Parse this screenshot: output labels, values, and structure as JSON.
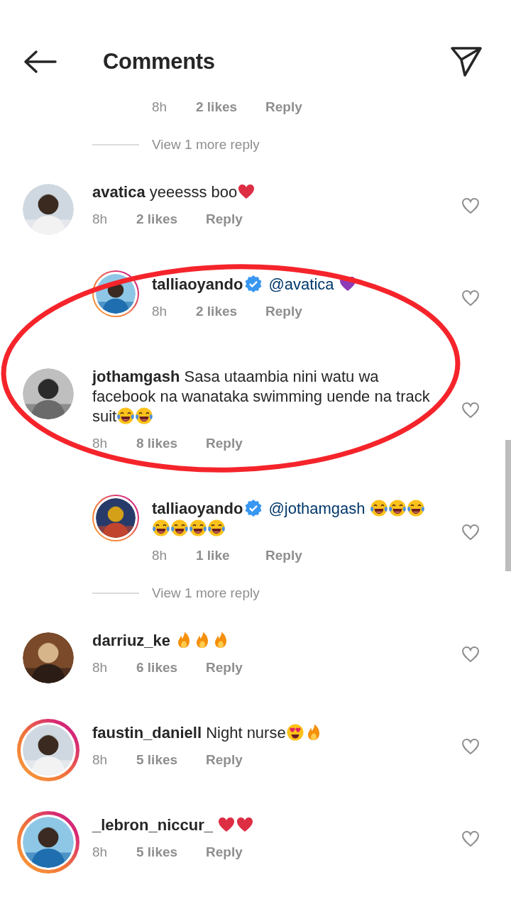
{
  "header": {
    "title": "Comments"
  },
  "highlight": {
    "kind": "ellipse"
  },
  "items": [
    {
      "kind": "reply_meta",
      "time": "8h",
      "likes": "2 likes",
      "reply_label": "Reply"
    },
    {
      "kind": "view_more",
      "label": "View 1 more reply"
    },
    {
      "kind": "comment",
      "user": "avatica",
      "verified": false,
      "story_ring": false,
      "text": "yeeesss boo",
      "emojis": [
        {
          "kind": "heart"
        }
      ],
      "time": "8h",
      "likes": "2 likes",
      "reply_label": "Reply",
      "liked": false,
      "children": [
        {
          "kind": "comment",
          "user": "talliaoyando",
          "verified": true,
          "story_ring": true,
          "mention": "@avatica",
          "emojis": [
            {
              "kind": "purple_heart"
            }
          ],
          "time": "8h",
          "likes": "2 likes",
          "reply_label": "Reply",
          "liked": false
        }
      ]
    },
    {
      "kind": "comment",
      "user": "jothamgash",
      "verified": false,
      "story_ring": false,
      "text": "Sasa utaambia nini watu wa facebook na wanataka swimming uende na track suit",
      "emojis": [
        {
          "kind": "laugh"
        },
        {
          "kind": "laugh"
        }
      ],
      "time": "8h",
      "likes": "8 likes",
      "reply_label": "Reply",
      "liked": false,
      "children": [
        {
          "kind": "comment",
          "user": "talliaoyando",
          "verified": true,
          "story_ring": true,
          "mention": "@jothamgash",
          "emojis": [
            {
              "kind": "laugh"
            },
            {
              "kind": "laugh"
            },
            {
              "kind": "laugh"
            },
            {
              "kind": "laugh"
            },
            {
              "kind": "laugh"
            },
            {
              "kind": "laugh"
            },
            {
              "kind": "laugh"
            }
          ],
          "time": "8h",
          "likes": "1 like",
          "reply_label": "Reply",
          "liked": false
        }
      ]
    },
    {
      "kind": "view_more",
      "label": "View 1 more reply"
    },
    {
      "kind": "comment",
      "user": "darriuz_ke",
      "verified": false,
      "story_ring": false,
      "emojis": [
        {
          "kind": "fire"
        },
        {
          "kind": "fire"
        },
        {
          "kind": "fire"
        }
      ],
      "time": "8h",
      "likes": "6 likes",
      "reply_label": "Reply",
      "liked": false
    },
    {
      "kind": "comment",
      "user": "faustin_daniell",
      "verified": false,
      "story_ring": true,
      "text": "Night nurse",
      "emojis": [
        {
          "kind": "heart_eyes"
        },
        {
          "kind": "fire"
        }
      ],
      "time": "8h",
      "likes": "5 likes",
      "reply_label": "Reply",
      "liked": false
    },
    {
      "kind": "comment",
      "user": "_lebron_niccur_",
      "verified": false,
      "story_ring": true,
      "emojis": [
        {
          "kind": "heart"
        },
        {
          "kind": "heart"
        }
      ],
      "time": "8h",
      "likes": "5 likes",
      "reply_label": "Reply",
      "liked": false
    }
  ]
}
